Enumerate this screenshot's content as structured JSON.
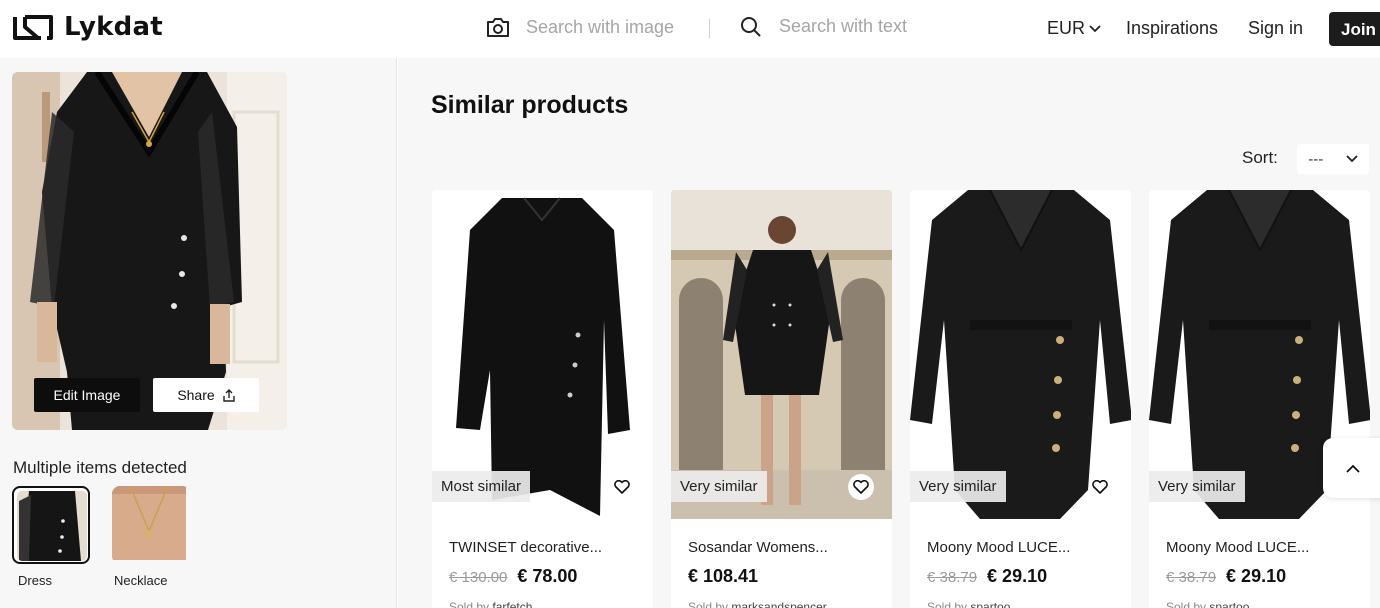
{
  "header": {
    "brand": "Lykdat",
    "search_image_placeholder": "Search with image",
    "search_text_placeholder": "Search with text",
    "currency": "EUR",
    "nav": {
      "inspirations": "Inspirations",
      "sign_in": "Sign in",
      "join": "Join"
    }
  },
  "sidebar": {
    "edit_image_label": "Edit Image",
    "share_label": "Share",
    "multiple_items_label": "Multiple items detected",
    "detected_items": [
      {
        "label": "Dress",
        "selected": true
      },
      {
        "label": "Necklace",
        "selected": false
      }
    ]
  },
  "main": {
    "title": "Similar products",
    "sort_label": "Sort:",
    "sort_value": "---",
    "products": [
      {
        "badge": "Most similar",
        "name": "TWINSET decorative...",
        "old_price": "€ 130.00",
        "price": "€ 78.00",
        "sold_by_prefix": "Sold by",
        "seller": "farfetch"
      },
      {
        "badge": "Very similar",
        "name": "Sosandar Womens...",
        "old_price": "",
        "price": "€ 108.41",
        "sold_by_prefix": "Sold by",
        "seller": "marksandspencer"
      },
      {
        "badge": "Very similar",
        "name": "Moony Mood LUCE...",
        "old_price": "€ 38.79",
        "price": "€ 29.10",
        "sold_by_prefix": "Sold by",
        "seller": "spartoo"
      },
      {
        "badge": "Very similar",
        "name": "Moony Mood LUCE...",
        "old_price": "€ 38.79",
        "price": "€ 29.10",
        "sold_by_prefix": "Sold by",
        "seller": "spartoo"
      }
    ]
  },
  "icons": {
    "camera": "camera-icon",
    "search": "search-icon",
    "chevron": "chevron-down-icon",
    "share": "share-icon",
    "heart": "heart-icon",
    "up": "chevron-up-icon"
  },
  "colors": {
    "background": "#f7f7f7",
    "join_button": "#1c1c1c",
    "edit_button": "#0d0d0d"
  }
}
